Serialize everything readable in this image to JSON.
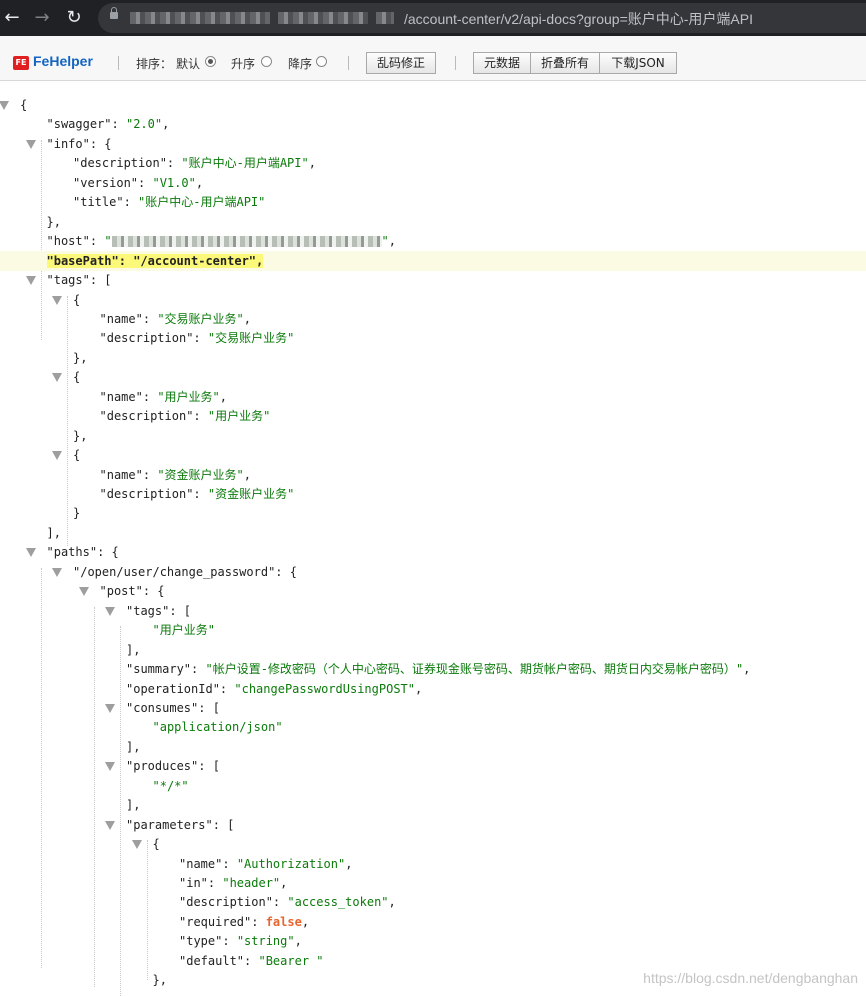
{
  "browser": {
    "back_icon": "arrow-left-icon",
    "forward_icon": "arrow-right-icon",
    "reload_icon": "reload-icon",
    "url_visible": "/account-center/v2/api-docs?group=账户中心-用户端API"
  },
  "toolbar": {
    "brand": "FeHelper",
    "logo_text": "FE",
    "sort_label": "排序：",
    "sort_default": "默认",
    "sort_asc": "升序",
    "sort_desc": "降序",
    "selected_sort": "默认",
    "fix_encoding": "乱码修正",
    "metadata": "元数据",
    "collapse_all": "折叠所有",
    "download_json": "下载JSON"
  },
  "json_lines": [
    {
      "depth": 0,
      "toggle": true,
      "parts": [
        [
          "p",
          "{"
        ]
      ]
    },
    {
      "depth": 1,
      "parts": [
        [
          "k",
          "\"swagger\""
        ],
        [
          "p",
          ":  "
        ],
        [
          "s",
          "\"2.0\""
        ],
        [
          "p",
          ","
        ]
      ]
    },
    {
      "depth": 1,
      "toggle": true,
      "parts": [
        [
          "k",
          "\"info\""
        ],
        [
          "p",
          ":  {"
        ]
      ]
    },
    {
      "depth": 2,
      "parts": [
        [
          "k",
          "\"description\""
        ],
        [
          "p",
          ":  "
        ],
        [
          "s",
          "\"账户中心-用户端API\""
        ],
        [
          "p",
          ","
        ]
      ]
    },
    {
      "depth": 2,
      "parts": [
        [
          "k",
          "\"version\""
        ],
        [
          "p",
          ":  "
        ],
        [
          "s",
          "\"V1.0\""
        ],
        [
          "p",
          ","
        ]
      ]
    },
    {
      "depth": 2,
      "parts": [
        [
          "k",
          "\"title\""
        ],
        [
          "p",
          ":  "
        ],
        [
          "s",
          "\"账户中心-用户端API\""
        ]
      ]
    },
    {
      "depth": 1,
      "parts": [
        [
          "p",
          "},"
        ]
      ]
    },
    {
      "depth": 1,
      "blur": true,
      "parts": [
        [
          "k",
          "\"host\""
        ],
        [
          "p",
          ":  "
        ],
        [
          "s",
          "\""
        ],
        [
          "b",
          ""
        ],
        [
          "s",
          "\""
        ],
        [
          "p",
          ","
        ]
      ]
    },
    {
      "depth": 1,
      "highlight": true,
      "parts": [
        [
          "k",
          "\"basePath\""
        ],
        [
          "p",
          ":  "
        ],
        [
          "s",
          "\"/account-center\""
        ],
        [
          "p",
          ","
        ]
      ]
    },
    {
      "depth": 1,
      "toggle": true,
      "parts": [
        [
          "k",
          "\"tags\""
        ],
        [
          "p",
          ":  ["
        ]
      ]
    },
    {
      "depth": 2,
      "toggle": true,
      "parts": [
        [
          "p",
          "{"
        ]
      ]
    },
    {
      "depth": 3,
      "parts": [
        [
          "k",
          "\"name\""
        ],
        [
          "p",
          ":  "
        ],
        [
          "s",
          "\"交易账户业务\""
        ],
        [
          "p",
          ","
        ]
      ]
    },
    {
      "depth": 3,
      "parts": [
        [
          "k",
          "\"description\""
        ],
        [
          "p",
          ":  "
        ],
        [
          "s",
          "\"交易账户业务\""
        ]
      ]
    },
    {
      "depth": 2,
      "parts": [
        [
          "p",
          "},"
        ]
      ]
    },
    {
      "depth": 2,
      "toggle": true,
      "parts": [
        [
          "p",
          "{"
        ]
      ]
    },
    {
      "depth": 3,
      "parts": [
        [
          "k",
          "\"name\""
        ],
        [
          "p",
          ":  "
        ],
        [
          "s",
          "\"用户业务\""
        ],
        [
          "p",
          ","
        ]
      ]
    },
    {
      "depth": 3,
      "parts": [
        [
          "k",
          "\"description\""
        ],
        [
          "p",
          ":  "
        ],
        [
          "s",
          "\"用户业务\""
        ]
      ]
    },
    {
      "depth": 2,
      "parts": [
        [
          "p",
          "},"
        ]
      ]
    },
    {
      "depth": 2,
      "toggle": true,
      "parts": [
        [
          "p",
          "{"
        ]
      ]
    },
    {
      "depth": 3,
      "parts": [
        [
          "k",
          "\"name\""
        ],
        [
          "p",
          ":  "
        ],
        [
          "s",
          "\"资金账户业务\""
        ],
        [
          "p",
          ","
        ]
      ]
    },
    {
      "depth": 3,
      "parts": [
        [
          "k",
          "\"description\""
        ],
        [
          "p",
          ":  "
        ],
        [
          "s",
          "\"资金账户业务\""
        ]
      ]
    },
    {
      "depth": 2,
      "parts": [
        [
          "p",
          "}"
        ]
      ]
    },
    {
      "depth": 1,
      "parts": [
        [
          "p",
          "],"
        ]
      ]
    },
    {
      "depth": 1,
      "toggle": true,
      "parts": [
        [
          "k",
          "\"paths\""
        ],
        [
          "p",
          ":  {"
        ]
      ]
    },
    {
      "depth": 2,
      "toggle": true,
      "parts": [
        [
          "k",
          "\"/open/user/change_password\""
        ],
        [
          "p",
          ":  {"
        ]
      ]
    },
    {
      "depth": 3,
      "toggle": true,
      "parts": [
        [
          "k",
          "\"post\""
        ],
        [
          "p",
          ":  {"
        ]
      ]
    },
    {
      "depth": 4,
      "toggle": true,
      "parts": [
        [
          "k",
          "\"tags\""
        ],
        [
          "p",
          ":  ["
        ]
      ]
    },
    {
      "depth": 5,
      "parts": [
        [
          "s",
          "\"用户业务\""
        ]
      ]
    },
    {
      "depth": 4,
      "parts": [
        [
          "p",
          "],"
        ]
      ]
    },
    {
      "depth": 4,
      "parts": [
        [
          "k",
          "\"summary\""
        ],
        [
          "p",
          ":  "
        ],
        [
          "s",
          "\"帐户设置-修改密码（个人中心密码、证券现金账号密码、期货帐户密码、期货日内交易帐户密码）\""
        ],
        [
          "p",
          ","
        ]
      ]
    },
    {
      "depth": 4,
      "parts": [
        [
          "k",
          "\"operationId\""
        ],
        [
          "p",
          ":  "
        ],
        [
          "s",
          "\"changePasswordUsingPOST\""
        ],
        [
          "p",
          ","
        ]
      ]
    },
    {
      "depth": 4,
      "toggle": true,
      "parts": [
        [
          "k",
          "\"consumes\""
        ],
        [
          "p",
          ":  ["
        ]
      ]
    },
    {
      "depth": 5,
      "parts": [
        [
          "s",
          "\"application/json\""
        ]
      ]
    },
    {
      "depth": 4,
      "parts": [
        [
          "p",
          "],"
        ]
      ]
    },
    {
      "depth": 4,
      "toggle": true,
      "parts": [
        [
          "k",
          "\"produces\""
        ],
        [
          "p",
          ":  ["
        ]
      ]
    },
    {
      "depth": 5,
      "parts": [
        [
          "s",
          "\"*/*\""
        ]
      ]
    },
    {
      "depth": 4,
      "parts": [
        [
          "p",
          "],"
        ]
      ]
    },
    {
      "depth": 4,
      "toggle": true,
      "parts": [
        [
          "k",
          "\"parameters\""
        ],
        [
          "p",
          ":  ["
        ]
      ]
    },
    {
      "depth": 5,
      "toggle": true,
      "parts": [
        [
          "p",
          "{"
        ]
      ]
    },
    {
      "depth": 6,
      "parts": [
        [
          "k",
          "\"name\""
        ],
        [
          "p",
          ":  "
        ],
        [
          "s",
          "\"Authorization\""
        ],
        [
          "p",
          ","
        ]
      ]
    },
    {
      "depth": 6,
      "parts": [
        [
          "k",
          "\"in\""
        ],
        [
          "p",
          ":  "
        ],
        [
          "s",
          "\"header\""
        ],
        [
          "p",
          ","
        ]
      ]
    },
    {
      "depth": 6,
      "parts": [
        [
          "k",
          "\"description\""
        ],
        [
          "p",
          ":  "
        ],
        [
          "s",
          "\"access_token\""
        ],
        [
          "p",
          ","
        ]
      ]
    },
    {
      "depth": 6,
      "parts": [
        [
          "k",
          "\"required\""
        ],
        [
          "p",
          ":  "
        ],
        [
          "bo",
          "false"
        ],
        [
          "p",
          ","
        ]
      ]
    },
    {
      "depth": 6,
      "parts": [
        [
          "k",
          "\"type\""
        ],
        [
          "p",
          ":  "
        ],
        [
          "s",
          "\"string\""
        ],
        [
          "p",
          ","
        ]
      ]
    },
    {
      "depth": 6,
      "parts": [
        [
          "k",
          "\"default\""
        ],
        [
          "p",
          ":  "
        ],
        [
          "s",
          "\"Bearer \""
        ]
      ]
    },
    {
      "depth": 5,
      "parts": [
        [
          "p",
          "},"
        ]
      ]
    }
  ],
  "watermark": "https://blog.csdn.net/dengbanghan",
  "colors": {
    "string": "#0b7a0b",
    "boolean": "#e8642d",
    "highlight": "#fbf87a",
    "brand": "#1565c0"
  }
}
